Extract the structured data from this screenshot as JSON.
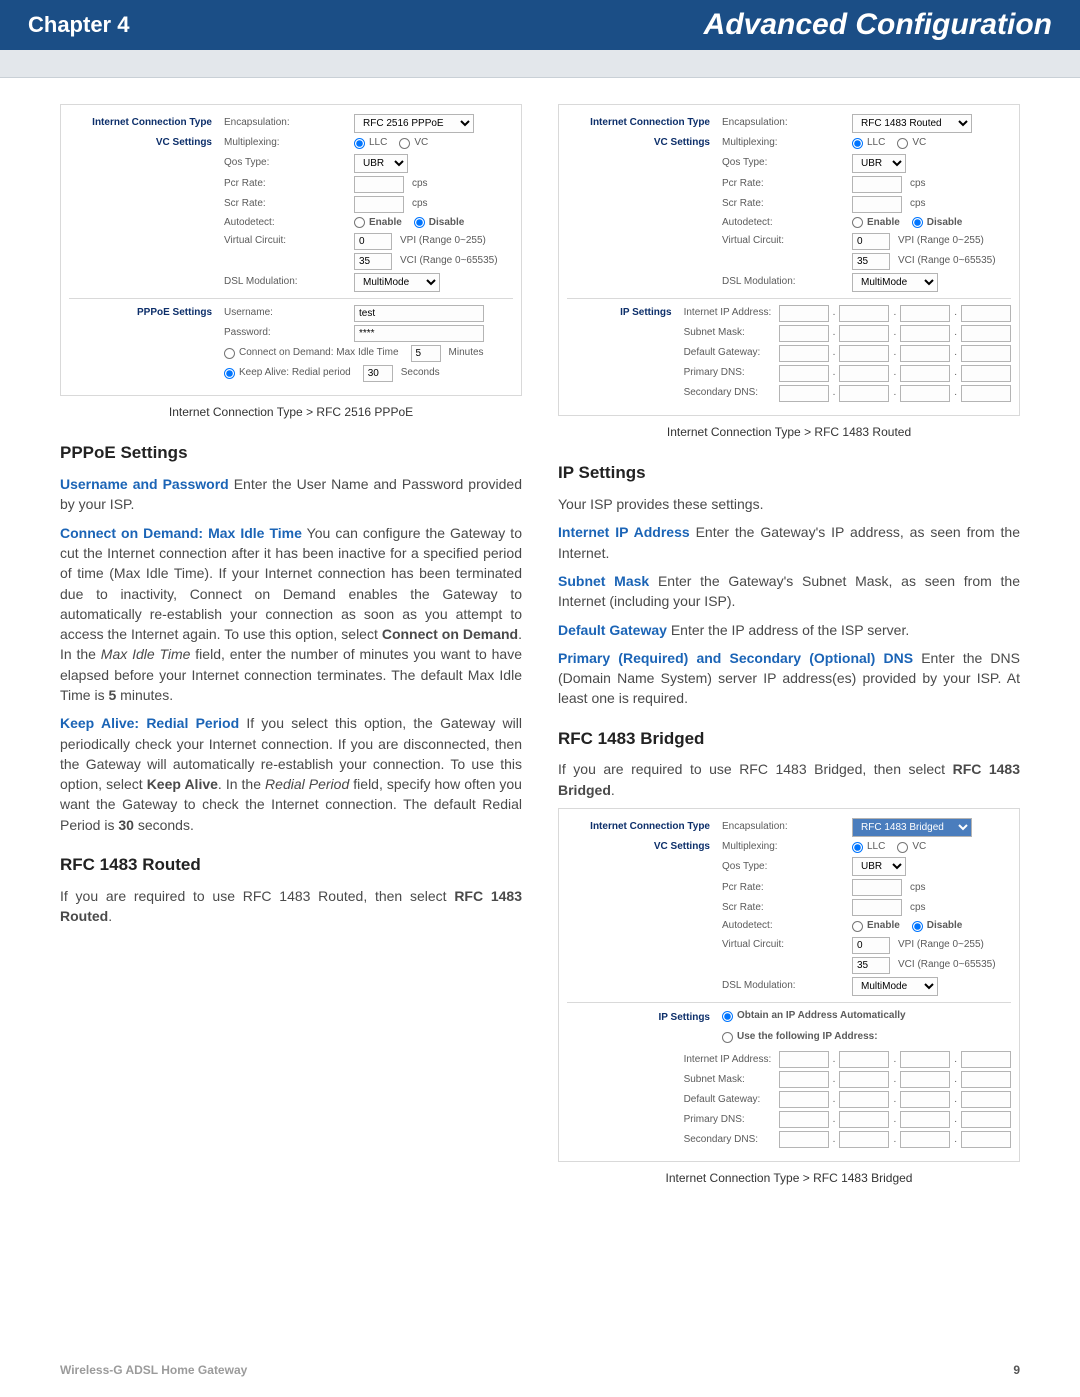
{
  "header": {
    "chapter": "Chapter 4",
    "title": "Advanced Configuration"
  },
  "footer": {
    "product": "Wireless-G ADSL Home Gateway",
    "page": "9"
  },
  "common_labels": {
    "ict": "Internet Connection Type",
    "vc": "VC Settings",
    "encapsulation": "Encapsulation:",
    "multiplexing": "Multiplexing:",
    "llc": "LLC",
    "vc_opt": "VC",
    "qos_type": "Qos Type:",
    "ubr": "UBR",
    "pcr": "Pcr Rate:",
    "scr": "Scr Rate:",
    "cps": "cps",
    "autodetect": "Autodetect:",
    "enable": "Enable",
    "disable": "Disable",
    "virtual_circuit": "Virtual Circuit:",
    "vpi_range": "VPI (Range 0~255)",
    "vci_val": "35",
    "vci_range": "VCI (Range 0~65535)",
    "dsl_mod": "DSL Modulation:",
    "multimode": "MultiMode",
    "ip_settings": "IP Settings",
    "iip": "Internet IP Address:",
    "subnet": "Subnet Mask:",
    "gateway": "Default Gateway:",
    "pdns": "Primary DNS:",
    "sdns": "Secondary DNS:"
  },
  "fig1": {
    "encap_sel": "RFC 2516 PPPoE",
    "vpi_val": "0",
    "pppoe_section": "PPPoE Settings",
    "username_lbl": "Username:",
    "username_val": "test",
    "password_lbl": "Password:",
    "password_val": "****",
    "cod_lbl": "Connect on Demand: Max Idle Time",
    "cod_val": "5",
    "minutes": "Minutes",
    "keep_lbl": "Keep Alive: Redial period",
    "keep_val": "30",
    "seconds": "Seconds",
    "caption": "Internet Connection Type > RFC 2516 PPPoE"
  },
  "fig2": {
    "encap_sel": "RFC 1483 Routed",
    "vpi_val": "0",
    "caption": "Internet Connection Type > RFC 1483 Routed"
  },
  "fig3": {
    "encap_sel": "RFC 1483 Bridged",
    "vpi_val": "0",
    "auto_ip": "Obtain an IP Address Automatically",
    "use_ip": "Use the following IP Address:",
    "caption": "Internet Connection Type > RFC 1483 Bridged"
  },
  "text": {
    "h_pppoe": "PPPoE Settings",
    "p_user_kw": "Username and Password",
    "p_user": " Enter the User Name and Password provided by your ISP.",
    "p_cod_kw": "Connect on Demand: Max Idle Time",
    "p_cod_a": " You can configure the Gateway to cut the Internet connection after it has been inactive for a specified period of time (Max Idle Time). If your Internet connection has been terminated due to inactivity, Connect on Demand enables the Gateway to automatically re-establish your connection as soon as you attempt to access the Internet again. To use this option, select ",
    "p_cod_b": "Connect on Demand",
    "p_cod_c": ". In the ",
    "p_cod_d": "Max Idle Time",
    "p_cod_e": " field, enter the number of minutes you want to have elapsed before your Internet connection terminates. The default Max Idle Time is ",
    "p_cod_f": "5",
    "p_cod_g": " minutes.",
    "p_keep_kw": "Keep Alive: Redial Period",
    "p_keep_a": " If you select this option, the Gateway will periodically check your Internet connection. If you are disconnected, then the Gateway will automatically re-establish your connection. To use this option, select ",
    "p_keep_b": "Keep Alive",
    "p_keep_c": ". In the ",
    "p_keep_d": "Redial Period",
    "p_keep_e": " field, specify how often you want the Gateway to check the Internet connection. The default Redial Period is ",
    "p_keep_f": "30",
    "p_keep_g": " seconds.",
    "h_routed": "RFC 1483 Routed",
    "p_routed_a": "If you are required to use RFC 1483 Routed, then select ",
    "p_routed_b": "RFC 1483 Routed",
    "p_routed_c": ".",
    "h_ips": "IP Settings",
    "p_ips": "Your ISP provides these settings.",
    "p_iip_kw": "Internet IP Address",
    "p_iip": " Enter the Gateway's IP address, as seen from the Internet.",
    "p_sn_kw": "Subnet Mask",
    "p_sn": " Enter the Gateway's Subnet Mask, as seen from the Internet (including your ISP).",
    "p_dg_kw": "Default Gateway",
    "p_dg": " Enter the IP address of the ISP server.",
    "p_dns_kw": "Primary (Required) and Secondary (Optional) DNS",
    "p_dns": " Enter the DNS (Domain Name System) server IP address(es) provided by your ISP. At least one is required.",
    "h_bridged": "RFC 1483 Bridged",
    "p_bridged_a": "If you are required to use RFC 1483 Bridged, then select ",
    "p_bridged_b": "RFC 1483 Bridged",
    "p_bridged_c": "."
  }
}
